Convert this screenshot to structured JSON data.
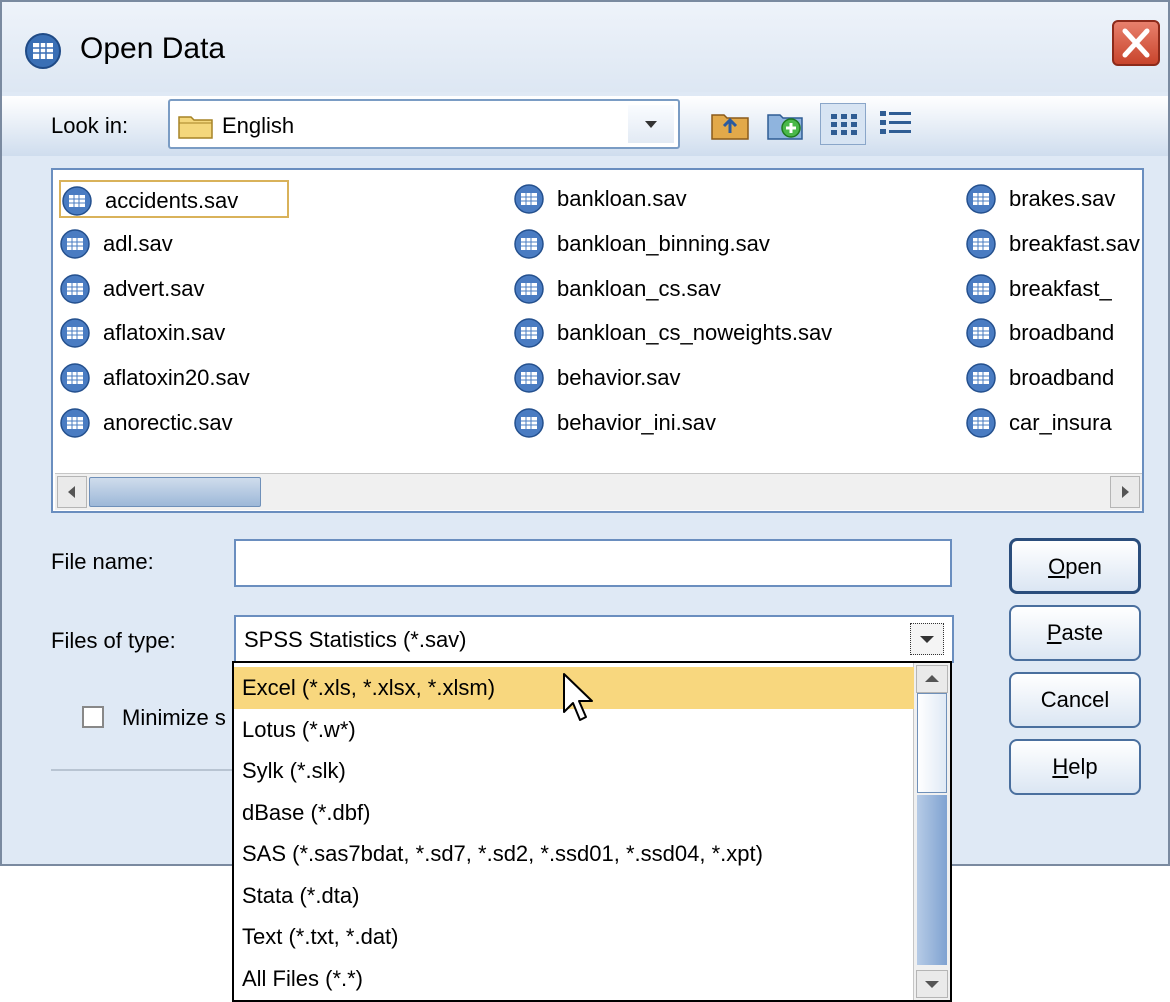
{
  "window": {
    "title": "Open Data",
    "close_icon": "close-icon"
  },
  "toolbar": {
    "look_in_label": "Look in:",
    "look_in_value": "English",
    "icons": [
      "up-folder-icon",
      "new-folder-icon",
      "list-view-icon",
      "details-view-icon"
    ]
  },
  "files": {
    "columns": [
      [
        "accidents.sav",
        "adl.sav",
        "advert.sav",
        "aflatoxin.sav",
        "aflatoxin20.sav",
        "anorectic.sav"
      ],
      [
        "bankloan.sav",
        "bankloan_binning.sav",
        "bankloan_cs.sav",
        "bankloan_cs_noweights.sav",
        "behavior.sav",
        "behavior_ini.sav"
      ],
      [
        "brakes.sav",
        "breakfast.sav",
        "breakfast_",
        "broadband",
        "broadband",
        "car_insura"
      ]
    ],
    "selected": "accidents.sav"
  },
  "form": {
    "file_name_label": "File name:",
    "file_name_value": "",
    "files_of_type_label": "Files of type:",
    "files_of_type_value": "SPSS Statistics (*.sav)",
    "minimize_label": "Minimize s"
  },
  "buttons": {
    "open": "Open",
    "paste": "Paste",
    "cancel": "Cancel",
    "help": "Help"
  },
  "dropdown": {
    "options": [
      "Excel (*.xls, *.xlsx, *.xlsm)",
      "Lotus (*.w*)",
      "Sylk (*.slk)",
      "dBase (*.dbf)",
      "SAS (*.sas7bdat, *.sd7, *.sd2, *.ssd01, *.ssd04, *.xpt)",
      "Stata (*.dta)",
      "Text (*.txt, *.dat)",
      "All Files (*.*)"
    ],
    "highlighted_index": 0
  },
  "colors": {
    "highlight": "#f8d77e",
    "window_bg": "#dfe9f5",
    "border_blue": "#6a8ebf"
  }
}
